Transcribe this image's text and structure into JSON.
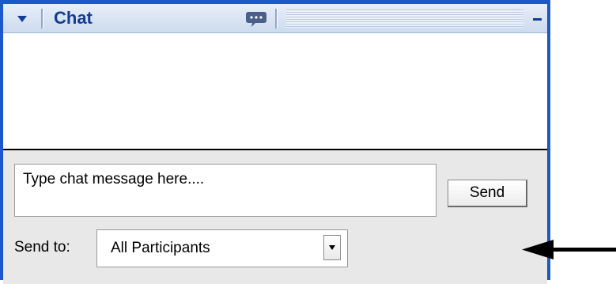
{
  "panel": {
    "title": "Chat",
    "icons": {
      "collapse": "chevron-down-icon",
      "chat": "speech-bubble-icon",
      "minimize": "minimize-icon"
    }
  },
  "compose": {
    "message_placeholder": "Type chat message here....",
    "send_label": "Send",
    "send_to_label": "Send to:",
    "send_to_selected": "All Participants"
  },
  "annotation": {
    "arrow": "left-arrow-icon"
  },
  "colors": {
    "frame": "#1b58c9",
    "title_text": "#123d93",
    "compose_bg": "#e8e8e8"
  }
}
